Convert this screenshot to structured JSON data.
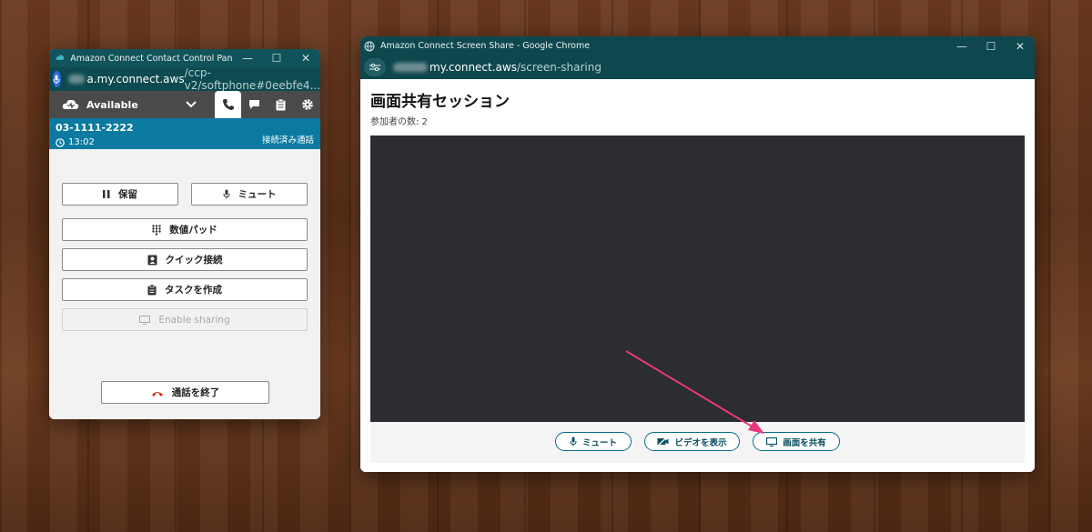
{
  "ccp": {
    "title": "Amazon Connect Contact Control Panel | Softp...",
    "url_domain": "a.my.connect.aws",
    "url_path": "/ccp-v2/softphone#0eebfe4...",
    "status": "Available",
    "phone_number": "03-1111-2222",
    "duration": "13:02",
    "call_state": "接続済み通話",
    "buttons": {
      "hold": "保留",
      "mute": "ミュート",
      "numpad": "数値パッド",
      "quick_connect": "クイック接続",
      "create_task": "タスクを作成",
      "enable_sharing": "Enable sharing",
      "end_call": "通話を終了"
    }
  },
  "chrome": {
    "title": "Amazon Connect Screen Share - Google Chrome",
    "url_domain": "my.connect.aws",
    "url_path": "/screen-sharing",
    "page_title": "画面共有セッション",
    "participants": "参加者の数: 2",
    "controls": {
      "mute": "ミュート",
      "show_video": "ビデオを表示",
      "share_screen": "画面を共有"
    }
  },
  "colors": {
    "ccp_titlebar": "#11535a",
    "ccp_call_banner": "#0a7aa0",
    "chrome_titlebar": "#0f474e",
    "video_area": "#2b2d33",
    "pill_border": "#0a6e86",
    "annotation_arrow": "#e8387a"
  }
}
